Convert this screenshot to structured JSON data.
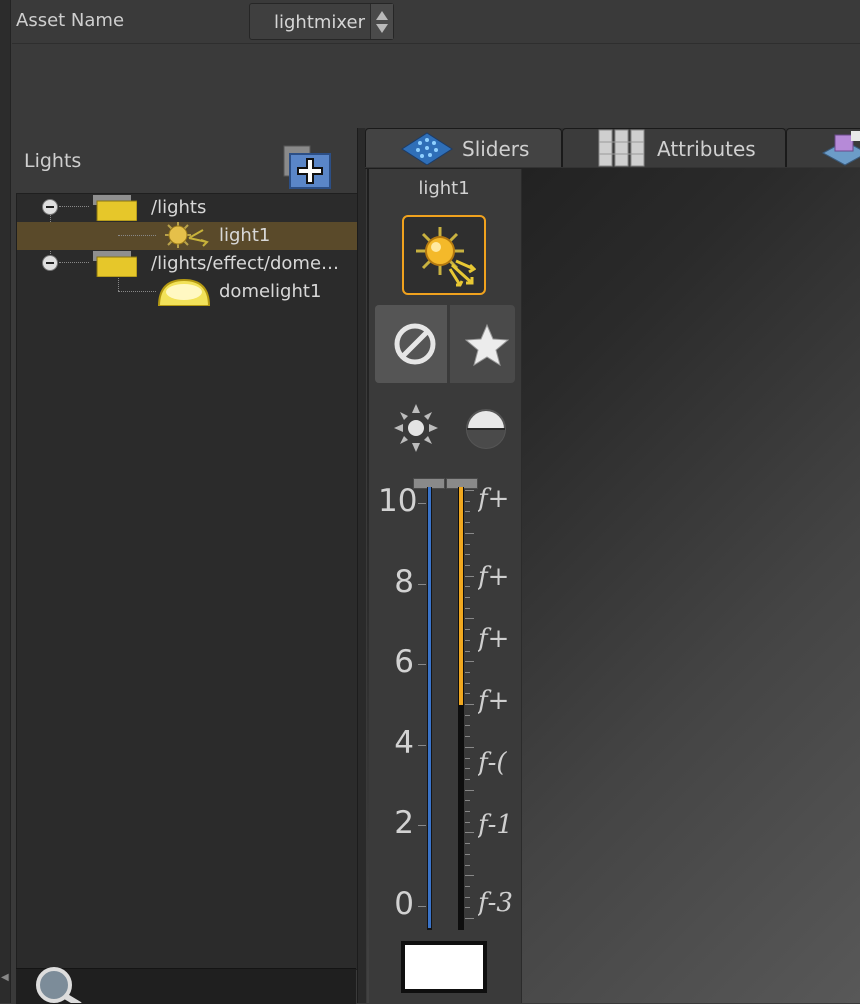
{
  "asset": {
    "label": "Asset Name",
    "value": "lightmixer"
  },
  "lights_panel": {
    "title": "Lights",
    "tree": [
      {
        "label": "/lights",
        "kind": "group",
        "icon": "folder-icon"
      },
      {
        "label": "light1",
        "kind": "light",
        "icon": "sun-light-icon",
        "selected": true
      },
      {
        "label": "/lights/effect/dome…",
        "kind": "group",
        "icon": "folder-icon"
      },
      {
        "label": "domelight1",
        "kind": "light",
        "icon": "dome-light-icon"
      }
    ]
  },
  "tabs": [
    {
      "label": "Sliders",
      "icon": "sliders-grid-icon",
      "active": true
    },
    {
      "label": "Attributes",
      "icon": "attributes-columns-icon",
      "active": false
    },
    {
      "label": "",
      "icon": "scene-icon",
      "active": false
    }
  ],
  "light_strip": {
    "name": "light1",
    "intensity_ticks": [
      "10",
      "8",
      "6",
      "4",
      "2",
      "0"
    ],
    "intensity_value": 10,
    "exposure_fraction": 0.5,
    "exposure_labels": [
      "ƒ+",
      "ƒ+",
      "ƒ+",
      "ƒ+",
      "ƒ-(",
      "ƒ-1",
      "ƒ-3"
    ]
  },
  "colors": {
    "selection": "#5a4a2a",
    "accent_orange": "#f0a820",
    "slider_blue": "#3a73c8"
  }
}
